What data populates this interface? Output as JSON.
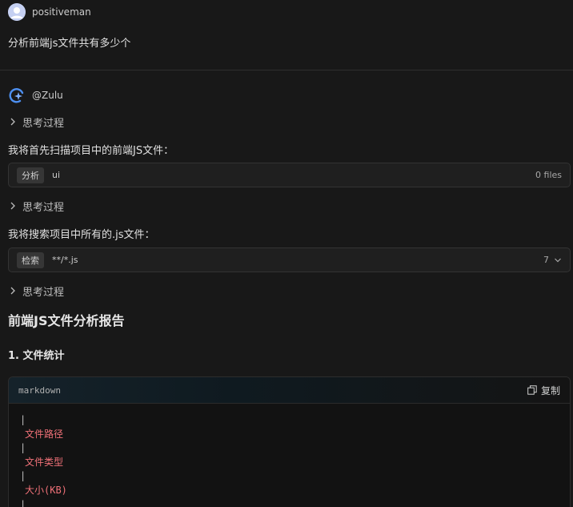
{
  "user": {
    "name": "positiveman",
    "message": "分析前端js文件共有多少个"
  },
  "bot": {
    "name": "@Zulu"
  },
  "thinking_label": "思考过程",
  "paragraphs": [
    "我将首先扫描项目中的前端JS文件：",
    "我将搜索项目中所有的.js文件："
  ],
  "tools": [
    {
      "tag": "分析",
      "arg": "ui",
      "result": "0 files"
    },
    {
      "tag": "检索",
      "arg": "**/*.js",
      "result": "7"
    }
  ],
  "report": {
    "title": "前端JS文件分析报告",
    "section": "1. 文件统计",
    "code": {
      "lang": "markdown",
      "copy_label": "复制",
      "lines": [
        "|",
        "文件路径",
        "|",
        "文件类型",
        "|",
        "大小(KB)",
        "|"
      ]
    }
  },
  "colors": {
    "background": "#181818",
    "code_red": "#f07178"
  }
}
